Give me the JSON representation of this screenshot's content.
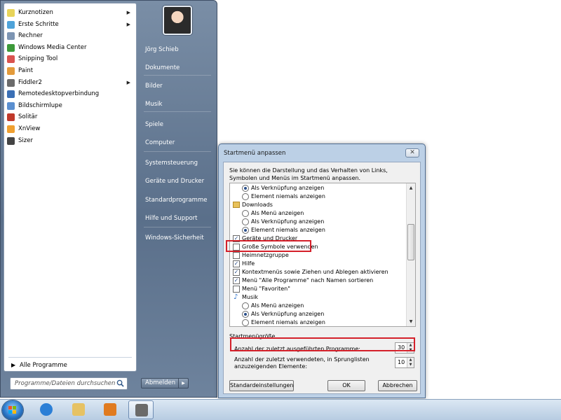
{
  "start_menu": {
    "programs": [
      {
        "label": "Kurznotizen",
        "icon": "sticky-notes-icon",
        "icon_color": "#e8d45a",
        "submenu": true
      },
      {
        "label": "Erste Schritte",
        "icon": "getting-started-icon",
        "icon_color": "#4fa3d9",
        "submenu": true
      },
      {
        "label": "Rechner",
        "icon": "calculator-icon",
        "icon_color": "#7d95b3",
        "submenu": false
      },
      {
        "label": "Windows Media Center",
        "icon": "media-center-icon",
        "icon_color": "#3d9a3a",
        "submenu": false
      },
      {
        "label": "Snipping Tool",
        "icon": "scissors-icon",
        "icon_color": "#d9534f",
        "submenu": false
      },
      {
        "label": "Paint",
        "icon": "paint-icon",
        "icon_color": "#e39b3b",
        "submenu": false
      },
      {
        "label": "Fiddler2",
        "icon": "fiddler-icon",
        "icon_color": "#6b6b6b",
        "submenu": true
      },
      {
        "label": "Remotedesktopverbindung",
        "icon": "remote-desktop-icon",
        "icon_color": "#3a6fb5",
        "submenu": false
      },
      {
        "label": "Bildschirmlupe",
        "icon": "magnifier-icon",
        "icon_color": "#5a8fd0",
        "submenu": false
      },
      {
        "label": "Solitär",
        "icon": "cards-icon",
        "icon_color": "#c0392b",
        "submenu": false
      },
      {
        "label": "XnView",
        "icon": "xnview-icon",
        "icon_color": "#f0a030",
        "submenu": false
      },
      {
        "label": "Sizer",
        "icon": "move-arrows-icon",
        "icon_color": "#444444",
        "submenu": false
      }
    ],
    "all_programs": "Alle Programme",
    "search_placeholder": "Programme/Dateien durchsuchen",
    "places": [
      "Jörg Schieb",
      "Dokumente",
      "Bilder",
      "Musik",
      "Spiele",
      "Computer",
      "Systemsteuerung",
      "Geräte und Drucker",
      "Standardprogramme",
      "Hilfe und Support",
      "Windows-Sicherheit"
    ],
    "shutdown_label": "Abmelden"
  },
  "dialog": {
    "title": "Startmenü anpassen",
    "close": "✕",
    "description": "Sie können die Darstellung und das Verhalten von Links, Symbolen und Menüs im Startmenü anpassen.",
    "options": [
      {
        "kind": "radio",
        "label": "Als Verknüpfung anzeigen",
        "checked": true,
        "indent": 1
      },
      {
        "kind": "radio",
        "label": "Element niemals anzeigen",
        "checked": false,
        "indent": 1
      },
      {
        "kind": "folder",
        "label": "Downloads",
        "indent": 0
      },
      {
        "kind": "radio",
        "label": "Als Menü anzeigen",
        "checked": false,
        "indent": 1
      },
      {
        "kind": "radio",
        "label": "Als Verknüpfung anzeigen",
        "checked": false,
        "indent": 1
      },
      {
        "kind": "radio",
        "label": "Element niemals anzeigen",
        "checked": true,
        "indent": 1
      },
      {
        "kind": "checkbox",
        "label": "Geräte und Drucker",
        "checked": true,
        "indent": 0
      },
      {
        "kind": "checkbox",
        "label": "Große Symbole verwenden",
        "checked": false,
        "indent": 0
      },
      {
        "kind": "checkbox",
        "label": "Heimnetzgruppe",
        "checked": false,
        "indent": 0
      },
      {
        "kind": "checkbox",
        "label": "Hilfe",
        "checked": true,
        "indent": 0
      },
      {
        "kind": "checkbox",
        "label": "Kontextmenüs sowie Ziehen und Ablegen aktivieren",
        "checked": true,
        "indent": 0
      },
      {
        "kind": "checkbox",
        "label": "Menü \"Alle Programme\" nach Namen sortieren",
        "checked": true,
        "indent": 0
      },
      {
        "kind": "checkbox",
        "label": "Menü \"Favoriten\"",
        "checked": false,
        "indent": 0
      },
      {
        "kind": "music",
        "label": "Musik",
        "indent": 0
      },
      {
        "kind": "radio",
        "label": "Als Menü anzeigen",
        "checked": false,
        "indent": 1
      },
      {
        "kind": "radio",
        "label": "Als Verknüpfung anzeigen",
        "checked": true,
        "indent": 1
      },
      {
        "kind": "radio",
        "label": "Element niemals anzeigen",
        "checked": false,
        "indent": 1
      }
    ],
    "size_group": "Startmenügröße",
    "recent_programs_label": "Anzahl der zuletzt ausgeführten Programme:",
    "recent_programs_value": "30",
    "jump_list_label_1": "Anzahl der zuletzt verwendeten, in Sprunglisten",
    "jump_list_label_2": "anzuzeigenden Elemente:",
    "jump_list_value": "10",
    "defaults_button": "Standardeinstellungen",
    "ok_button": "OK",
    "cancel_button": "Abbrechen"
  },
  "taskbar": {
    "pinned": [
      {
        "name": "internet-explorer-icon",
        "color": "#2b7fd6"
      },
      {
        "name": "explorer-folder-icon",
        "color": "#e6c264"
      },
      {
        "name": "media-player-icon",
        "color": "#e07b20"
      },
      {
        "name": "server-app-icon",
        "color": "#6a6a6a"
      }
    ]
  },
  "colors": {
    "highlight": "#d4202a",
    "start_menu_blue": "#5a6f8a"
  }
}
